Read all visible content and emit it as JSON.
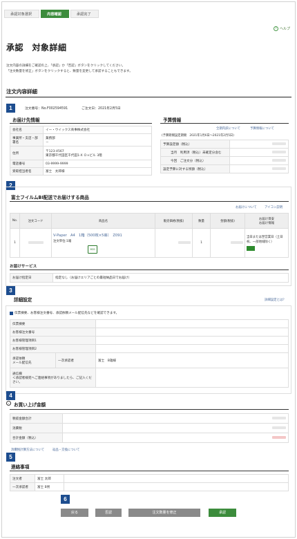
{
  "steps": [
    "承認対象選択",
    "内容確認",
    "承認完了"
  ],
  "help": "ヘルプ",
  "title": "承認　対象詳細",
  "intro": [
    "注文内容の詳細をご確認の上、「承認」か「否認」ボタンをクリックしてください。",
    "「注文数量を修正」ボタンをクリックすると、数量を変更して承認することもできます。"
  ],
  "order_header": "注文内容詳細",
  "order_no": "注文番号：No.F002594591",
  "order_date": "ご注文日：2021年2月5日",
  "badges": [
    "1",
    "2",
    "3",
    "4",
    "5",
    "6"
  ],
  "delivery": {
    "title": "お届け先情報",
    "rows": [
      {
        "k": "会社名",
        "v": "イー・ウイックス商事株式会社"
      },
      {
        "k": "事業所・支店・部署名",
        "v": "業務部\n－"
      },
      {
        "k": "住所",
        "v": "〒123-4567\n東京都千代田区千代田1-X Ｏ×ビル 3階"
      },
      {
        "k": "電話番号",
        "v": "03-9999-9999"
      },
      {
        "k": "受取担当者名",
        "v": "富士　太郎様"
      }
    ]
  },
  "budget": {
    "title": "予算情報",
    "links": [
      "全期内訳について",
      "予算情報について"
    ],
    "period": "(予算期間設定期間　2021年1月6日～2021年2月5日)",
    "rows": [
      {
        "k": "予算設定額（税込）",
        "v": ""
      },
      {
        "k": "当月　利用済（税込）未確定分含む",
        "v": ""
      },
      {
        "k": "今回　ご注文分（税込）",
        "v": ""
      },
      {
        "k": "設定予算に対する残額（税込）",
        "v": ""
      }
    ]
  },
  "products": {
    "title": "富士フイルムBI配送でお届けする商品",
    "links": [
      "お届けについて",
      "アイコン説明"
    ],
    "headers": [
      "No.",
      "注文コード",
      "商品名",
      "販売価格(税抜)",
      "数量",
      "金額(税抜)",
      "お届け目安\nお届け情報"
    ],
    "row": {
      "no": "1",
      "name": "V-Paper　A4　1箱（500枚×5冊）　Z091",
      "unit": "注文単位:1箱",
      "qty": "1",
      "eta": "当日または翌営業日（土日祝、一部地域除く）",
      "eco": "eco"
    },
    "service_title": "お届けサービス",
    "service_k": "お届け指定日",
    "service_v": "指定なし（お届けエリアごとの最短納品日でお届け）"
  },
  "detail": {
    "title": "詳細設定",
    "link": "詳細設定とは？",
    "note": "伝票摘要、お客様注文番号、承認依頼メール配信先などを確認できます。",
    "rows": [
      "伝票摘要",
      "お客様注文番号",
      "お客様管理項目1",
      "お客様管理項目2"
    ],
    "approval_k": "承認依頼\nメール配信先",
    "approval_sub": "一次承認者",
    "approval_v": "富士　B雄様",
    "msg_k": "通信欄\n＜承認者様宛へご連絡事項がありましたら、ご記入ください。"
  },
  "amount": {
    "title": "お買い上げ金額",
    "rows": [
      "税抜金額合計",
      "消費税",
      "合計金額（税込）"
    ],
    "links": [
      "消費税計算方法について",
      "返品・交換について"
    ]
  },
  "contact": {
    "title": "連絡事項",
    "rows": [
      {
        "k": "注文者",
        "v": "富士 太郎"
      },
      {
        "k": "一次承認者",
        "v": "富士 B男"
      }
    ]
  },
  "buttons": [
    "戻る",
    "否認",
    "注文数量を修正",
    "承認"
  ]
}
